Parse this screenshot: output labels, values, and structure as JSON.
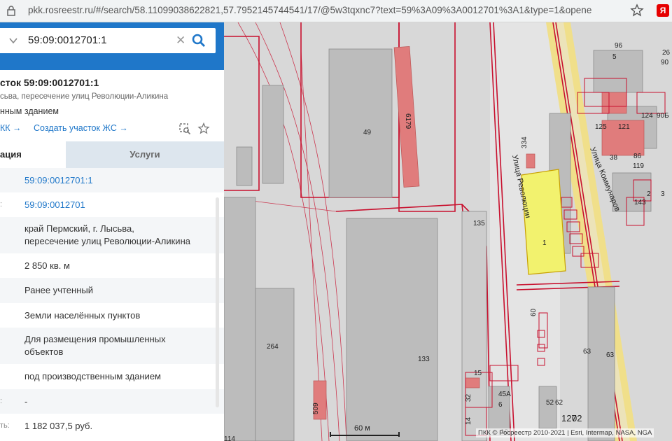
{
  "browser": {
    "url": "pkk.rosreestr.ru/#/search/58.11099038622821,57.7952145744541/17/@5w3tqxnc7?text=59%3A09%3A0012701%3A1&type=1&opene",
    "extension_label": "Я"
  },
  "search": {
    "value": "59:09:0012701:1"
  },
  "info": {
    "title": "сток 59:09:0012701:1",
    "address_short": "сьва, пересечение улиц Революции-Аликина",
    "status_line": "нным зданием",
    "link1": "КК →",
    "link2": "Создать участок ЖС →"
  },
  "tabs": [
    {
      "label": "ация"
    },
    {
      "label": "Услуги"
    }
  ],
  "rows": [
    {
      "label": "",
      "value": "59:09:0012701:1"
    },
    {
      "label": ":",
      "value": "59:09:0012701"
    },
    {
      "label": "",
      "value": "край Пермский, г. Лысьва,\nпересечение улиц Революции-Аликина"
    },
    {
      "label": "",
      "value": "2 850 кв. м"
    },
    {
      "label": "",
      "value": "Ранее учтенный"
    },
    {
      "label": "",
      "value": "Земли населённых пунктов"
    },
    {
      "label": "",
      "value": "Для размещения промышленных\nобъектов"
    },
    {
      "label": "",
      "value": "под производственным зданием"
    },
    {
      "label": ":",
      "value": "-"
    },
    {
      "label": "ть:",
      "value": "1 182 037,5 руб."
    }
  ],
  "map": {
    "labels": [
      "96",
      "5",
      "26",
      "90",
      "124",
      "90Б",
      "125",
      "121",
      "38",
      "86",
      "119",
      "49",
      "6179",
      "334",
      "1",
      "143",
      "2",
      "3",
      "135",
      "264",
      "133",
      "60",
      "63",
      "63",
      "15",
      "45А",
      "6",
      "52",
      "62",
      "127",
      "02",
      "509",
      "32",
      "14",
      "10",
      "114"
    ],
    "streets": [
      "Улица Революции",
      "Улица Коммунаров"
    ],
    "scale": "60 м",
    "copyright": "ПКК © Росреестр 2010-2021 | Esri, Intermap, NASA, NGA",
    "colors": {
      "selected_parcel": "#f2f26e",
      "parcel_border": "#c8102e",
      "building": "#e07c7c",
      "road": "#f0df8a"
    }
  }
}
